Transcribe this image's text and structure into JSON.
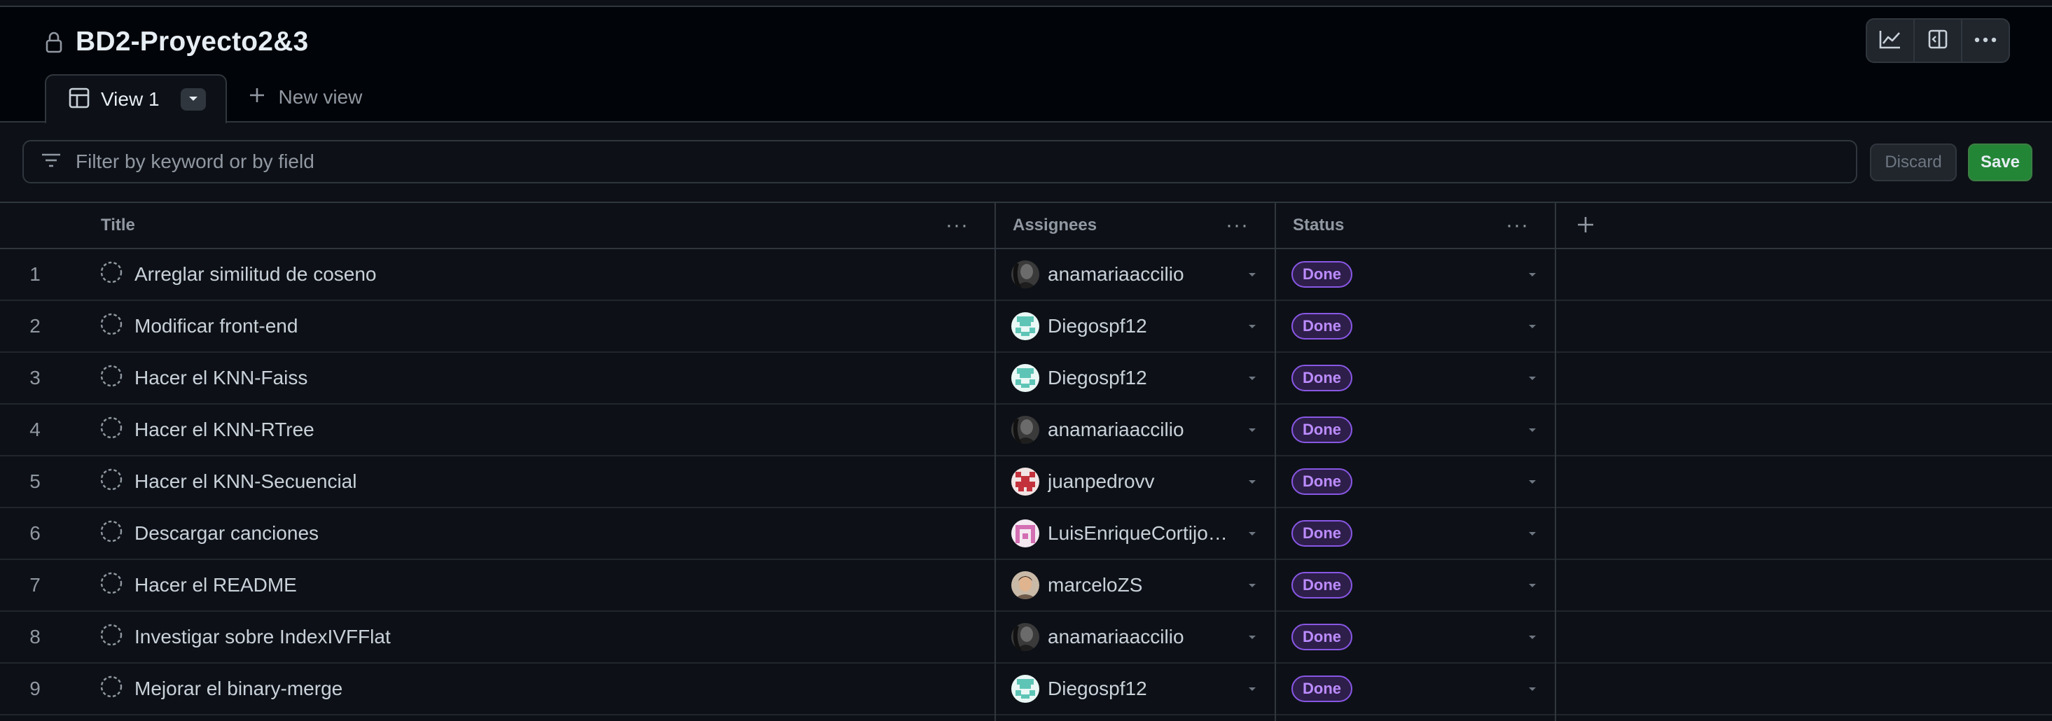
{
  "project": {
    "title": "BD2-Proyecto2&3"
  },
  "tabs": {
    "active_label": "View 1",
    "new_view_label": "New view"
  },
  "toolbar": {
    "icons": [
      "insights-icon",
      "side-panel-icon",
      "kebab-menu-icon"
    ]
  },
  "filter": {
    "placeholder": "Filter by keyword or by field",
    "discard_label": "Discard",
    "save_label": "Save"
  },
  "table": {
    "columns": [
      "Title",
      "Assignees",
      "Status"
    ],
    "rows": [
      {
        "num": "1",
        "title": "Arreglar similitud de coseno",
        "assignee": "anamariaaccilio",
        "avatar": "dark",
        "status": "Done"
      },
      {
        "num": "2",
        "title": "Modificar front-end",
        "assignee": "Diegospf12",
        "avatar": "teal",
        "status": "Done"
      },
      {
        "num": "3",
        "title": "Hacer el KNN-Faiss",
        "assignee": "Diegospf12",
        "avatar": "teal",
        "status": "Done"
      },
      {
        "num": "4",
        "title": "Hacer el KNN-RTree",
        "assignee": "anamariaaccilio",
        "avatar": "dark",
        "status": "Done"
      },
      {
        "num": "5",
        "title": "Hacer el KNN-Secuencial",
        "assignee": "juanpedrovv",
        "avatar": "red",
        "status": "Done"
      },
      {
        "num": "6",
        "title": "Descargar canciones",
        "assignee": "LuisEnriqueCortijo…",
        "avatar": "pink",
        "status": "Done"
      },
      {
        "num": "7",
        "title": "Hacer el README",
        "assignee": "marceloZS",
        "avatar": "photo",
        "status": "Done"
      },
      {
        "num": "8",
        "title": "Investigar sobre IndexIVFFlat",
        "assignee": "anamariaaccilio",
        "avatar": "dark",
        "status": "Done"
      },
      {
        "num": "9",
        "title": "Mejorar el binary-merge",
        "assignee": "Diegospf12",
        "avatar": "teal",
        "status": "Done"
      }
    ]
  },
  "colors": {
    "background": "#0d1117",
    "border": "#30363d",
    "status_done": "#8957e5",
    "save": "#238636"
  }
}
